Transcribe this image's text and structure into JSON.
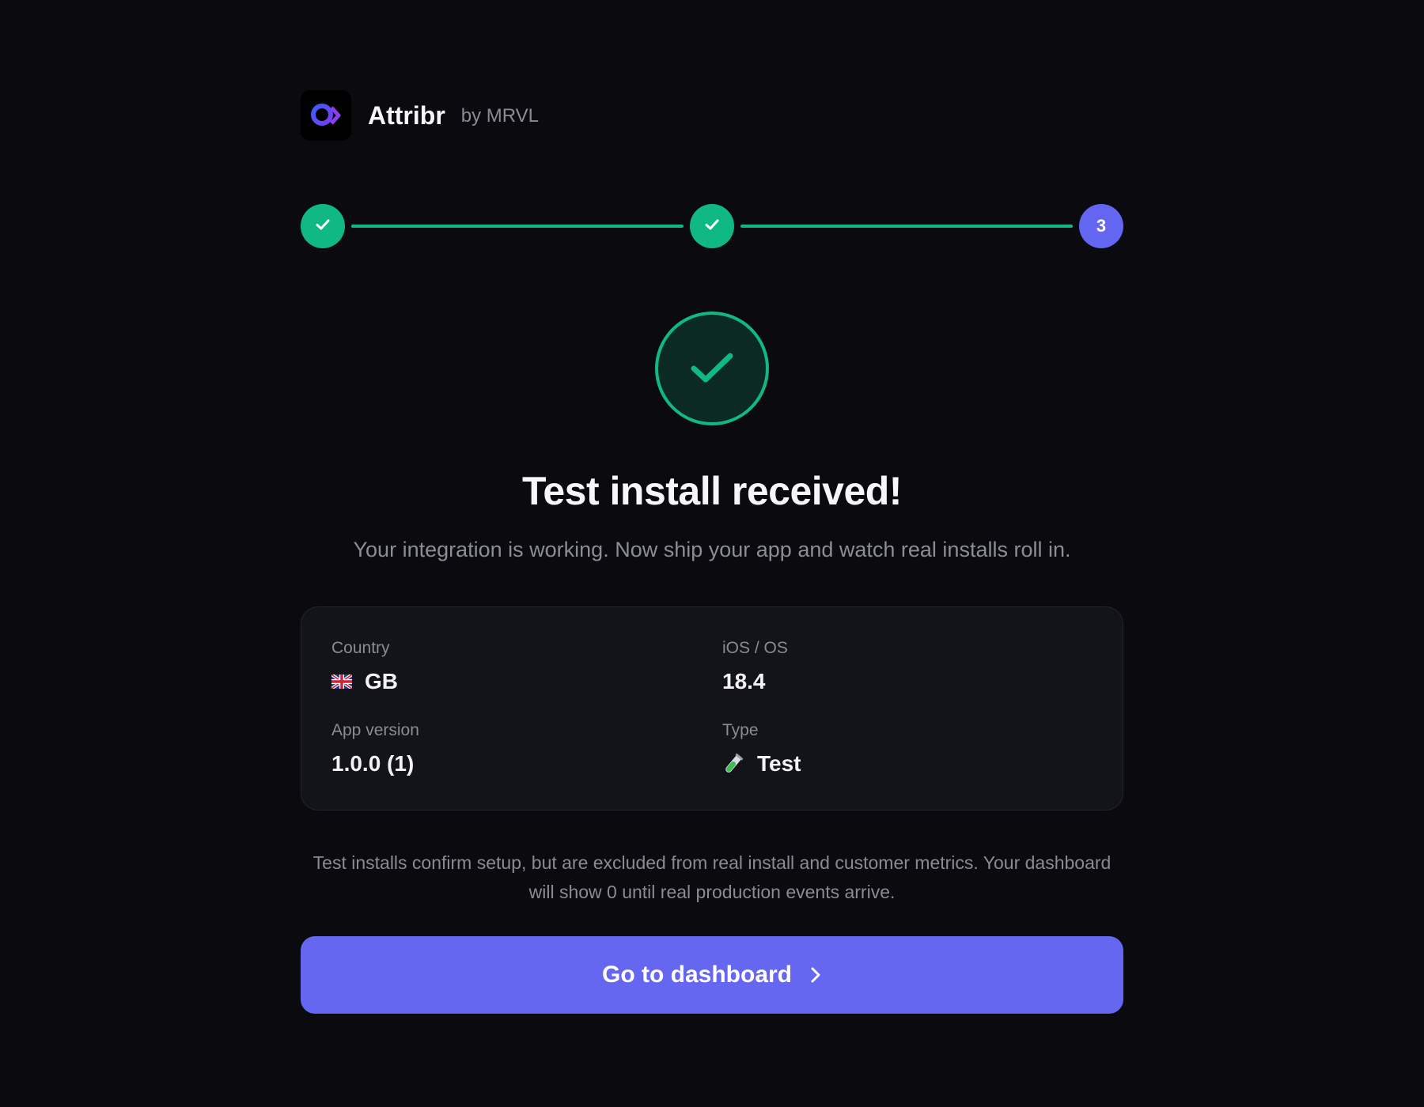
{
  "brand": {
    "name": "Attribr",
    "by": "by MRVL",
    "logo_icon": "attribr-logo-icon"
  },
  "stepper": {
    "steps": [
      {
        "state": "done",
        "icon": "check-icon"
      },
      {
        "state": "done",
        "icon": "check-icon"
      },
      {
        "state": "current",
        "label": "3"
      }
    ],
    "done_color": "#10b981",
    "current_color": "#6366f1"
  },
  "success": {
    "icon": "check-circle-icon",
    "title": "Test install received!",
    "subtitle": "Your integration is working. Now ship your app and watch real installs roll in."
  },
  "details": {
    "country": {
      "label": "Country",
      "value": "GB",
      "icon": "uk-flag-icon"
    },
    "os": {
      "label": "iOS / OS",
      "value": "18.4"
    },
    "app_version": {
      "label": "App version",
      "value": "1.0.0 (1)"
    },
    "type": {
      "label": "Type",
      "value": "Test",
      "icon": "test-tube-icon"
    }
  },
  "note": "Test installs confirm setup, but are excluded from real install and customer metrics. Your dashboard will show 0 until real production events arrive.",
  "cta": {
    "label": "Go to dashboard",
    "icon": "chevron-right-icon",
    "color": "#6567f1"
  }
}
